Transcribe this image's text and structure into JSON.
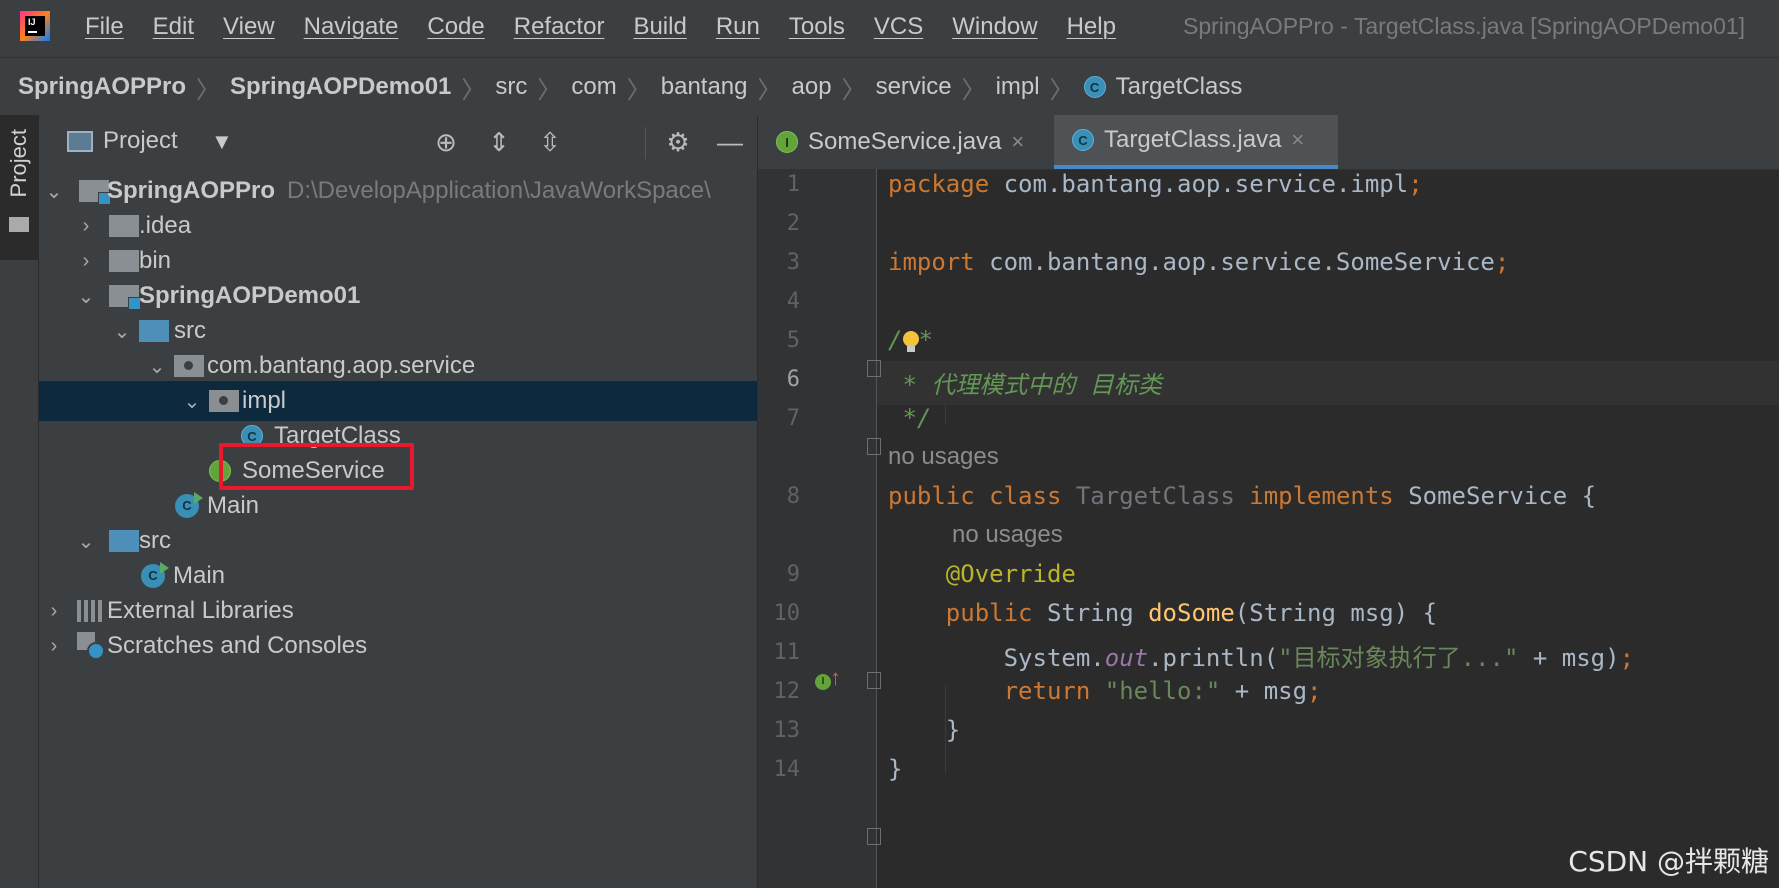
{
  "menubar": {
    "logo_text": "IJ",
    "items": [
      "File",
      "Edit",
      "View",
      "Navigate",
      "Code",
      "Refactor",
      "Build",
      "Run",
      "Tools",
      "VCS",
      "Window",
      "Help"
    ],
    "window_title": "SpringAOPPro - TargetClass.java [SpringAOPDemo01]"
  },
  "breadcrumb": {
    "items": [
      "SpringAOPPro",
      "SpringAOPDemo01",
      "src",
      "com",
      "bantang",
      "aop",
      "service",
      "impl",
      "TargetClass"
    ],
    "separator": "〉"
  },
  "stripe": {
    "label": "Project"
  },
  "project_panel": {
    "title": "Project",
    "tree": {
      "root": {
        "label": "SpringAOPPro",
        "path": "D:\\DevelopApplication\\JavaWorkSpace\\"
      },
      "idea": ".idea",
      "bin": "bin",
      "module": "SpringAOPDemo01",
      "src": "src",
      "package": "com.bantang.aop.service",
      "impl": "impl",
      "target_class": "TargetClass",
      "some_service": "SomeService",
      "main1": "Main",
      "src2": "src",
      "main2": "Main",
      "external_libraries": "External Libraries",
      "scratches": "Scratches and Consoles"
    }
  },
  "editor": {
    "tabs": [
      {
        "label": "SomeService.java",
        "icon": "interface-icon",
        "close": "×"
      },
      {
        "label": "TargetClass.java",
        "icon": "class-icon",
        "close": "×"
      }
    ],
    "line_numbers": [
      "1",
      "2",
      "3",
      "4",
      "5",
      "6",
      "7",
      "8",
      "9",
      "10",
      "11",
      "12",
      "13",
      "14"
    ],
    "current_line": "6",
    "code": {
      "l1_kw": "package",
      "l1_rest": " com.bantang.aop.service.impl",
      "l1_semi": ";",
      "l3_kw": "import",
      "l3_rest": " com.bantang.aop.service.SomeService",
      "l3_semi": ";",
      "l5_a": "/",
      "l5_b": "*",
      "l6": " * 代理模式中的 目标类",
      "l7": " */",
      "hint1": "no usages",
      "l8_public": "public",
      "l8_class": " class ",
      "l8_name": "TargetClass",
      "l8_impl": " implements ",
      "l8_rest": "SomeService {",
      "hint2": "no usages",
      "l9": "@Override",
      "l10_public": "public",
      "l10_type": " String ",
      "l10_fn": "doSome",
      "l10_rest": "(String msg) {",
      "l11_a": "System.",
      "l11_out": "out",
      "l11_b": ".println(",
      "l11_str": "\"目标对象执行了...\"",
      "l11_c": " + msg)",
      "l11_semi": ";",
      "l12_kw": "return",
      "l12_str": " \"hello:\"",
      "l12_rest": " + msg",
      "l12_semi": ";",
      "l13": "}",
      "l14": "}"
    }
  },
  "watermark": "CSDN @拌颗糖",
  "colors": {
    "keyword": "#cc7832",
    "comment": "#629755",
    "string": "#6a8759",
    "annotation": "#bbb529",
    "method": "#ffc66d",
    "highlight_box": "#e8192c"
  }
}
